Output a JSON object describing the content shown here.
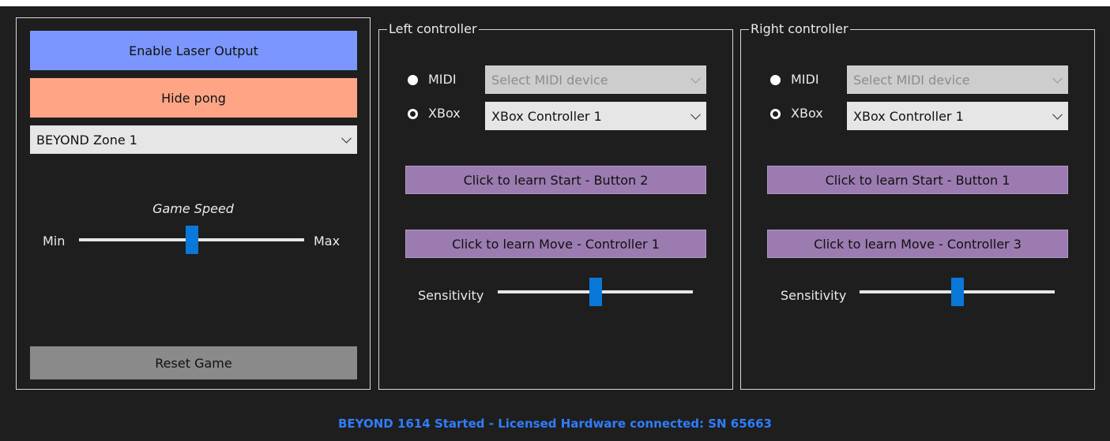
{
  "game_panel": {
    "enable_laser_label": "Enable Laser Output",
    "hide_pong_label": "Hide pong",
    "zone_select_value": "BEYOND Zone 1",
    "speed_title": "Game Speed",
    "speed_min_label": "Min",
    "speed_max_label": "Max",
    "speed_level": 0.5,
    "reset_label": "Reset Game"
  },
  "left_controller": {
    "title": "Left controller",
    "midi_label": "MIDI",
    "midi_select_placeholder": "Select MIDI device",
    "xbox_label": "XBox",
    "xbox_select_value": "XBox Controller 1",
    "learn_start_label": "Click to learn Start - Button 2",
    "learn_move_label": "Click to learn Move - Controller 1",
    "sensitivity_label": "Sensitivity",
    "sensitivity_level": 0.5
  },
  "right_controller": {
    "title": "Right controller",
    "midi_label": "MIDI",
    "midi_select_placeholder": "Select MIDI device",
    "xbox_label": "XBox",
    "xbox_select_value": "XBox Controller 1",
    "learn_start_label": "Click to learn Start - Button 1",
    "learn_move_label": "Click to learn Move - Controller 3",
    "sensitivity_label": "Sensitivity",
    "sensitivity_level": 0.5
  },
  "status_bar": {
    "text": "BEYOND 1614 Started - Licensed Hardware connected: SN 65663"
  },
  "colors": {
    "background": "#1e1e1e",
    "enable_button": "#7b97ff",
    "hide_button": "#ffa586",
    "learn_button": "#9b7bb0",
    "slider_thumb": "#0a78d8",
    "status_text": "#2f7dff"
  }
}
